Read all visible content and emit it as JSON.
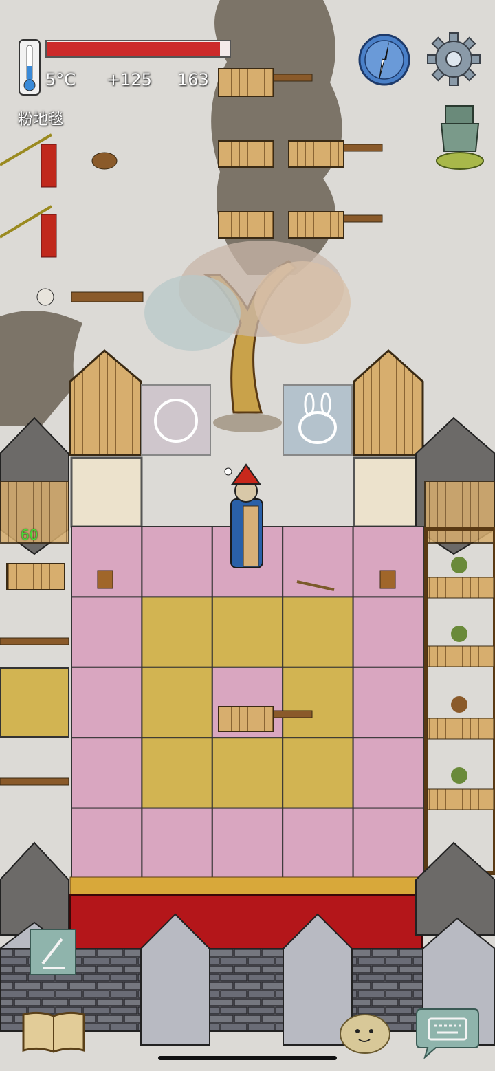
{
  "hud": {
    "temperature": "5°C",
    "yum_bonus": "+125",
    "yum_count": "163",
    "held_item": "粉地毯",
    "age": "60",
    "health_fraction": 0.95
  },
  "icons": {
    "thermometer": "thermometer-icon",
    "compass": "compass-icon",
    "settings": "gear-icon",
    "coin": "coin-icon",
    "note": "pencil-note-icon",
    "book": "open-book-icon",
    "emote": "potato-face-icon",
    "keyboard": "keyboard-icon"
  },
  "colors": {
    "health": "#cc2a2a",
    "pink_carpet": "#d9a6c0",
    "yellow_carpet": "#d2b452",
    "red_carpet": "#b4161a",
    "snow": "#dcdad6"
  }
}
